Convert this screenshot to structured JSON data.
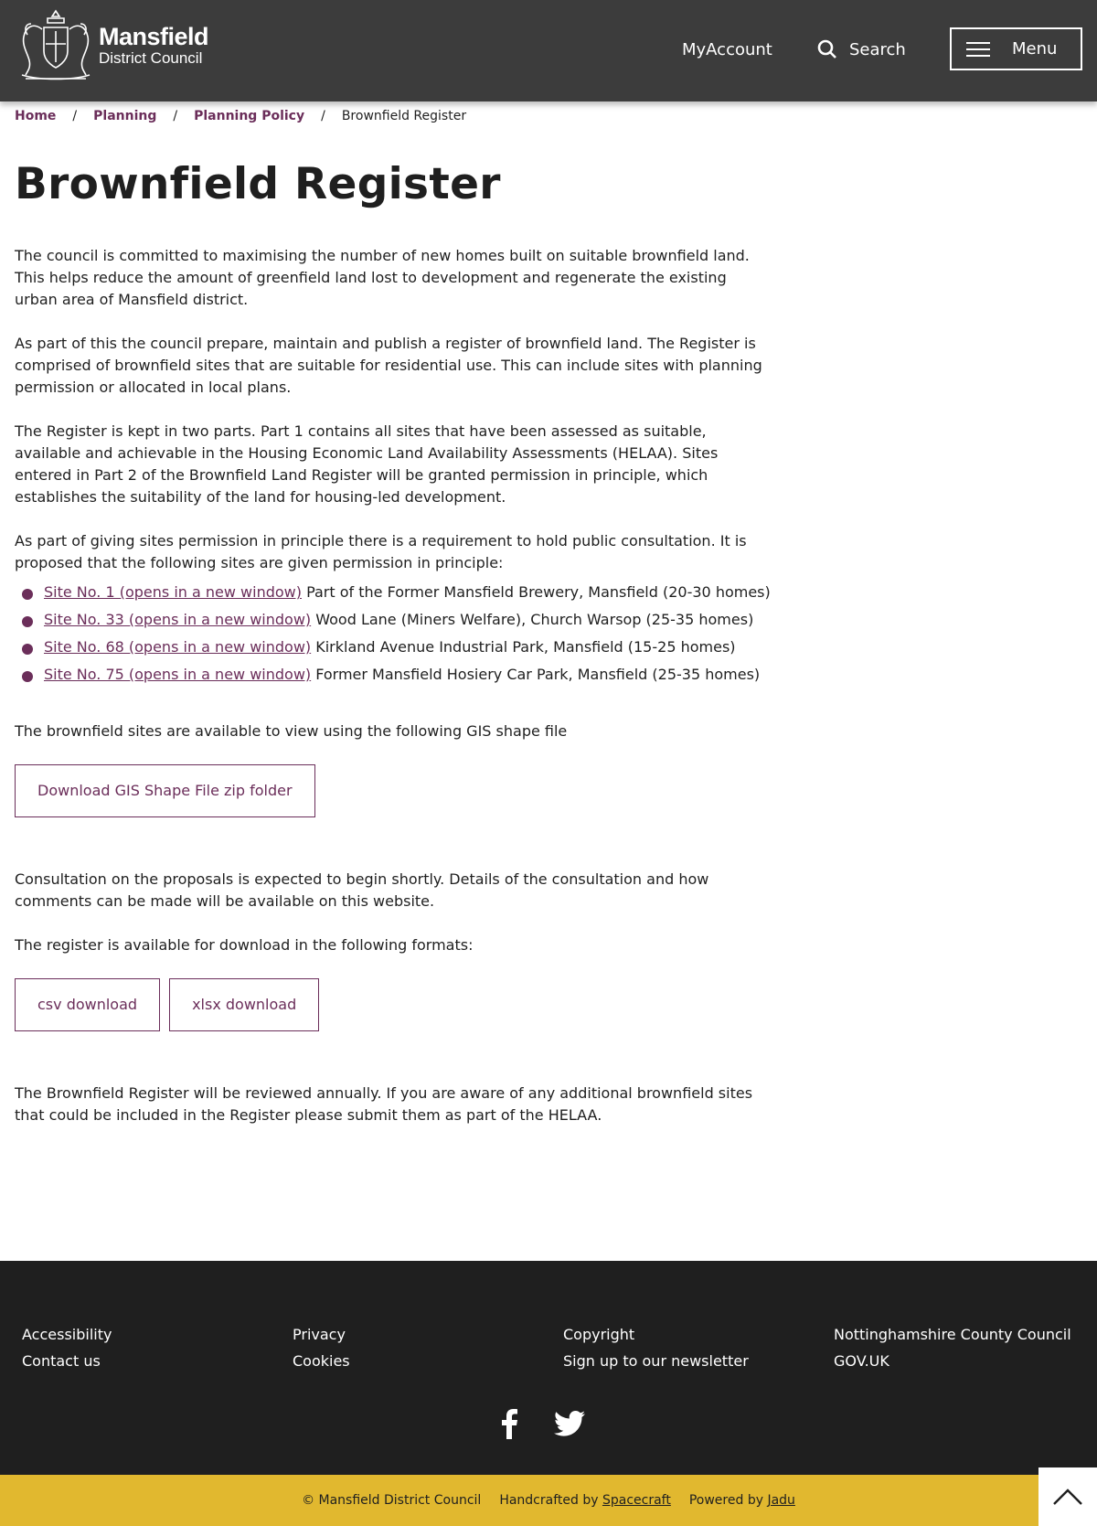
{
  "header": {
    "logo": {
      "name": "Mansfield",
      "subtitle": "District Council"
    },
    "myaccount_label": "MyAccount",
    "search_label": "Search",
    "menu_label": "Menu"
  },
  "breadcrumb": {
    "items": [
      "Home",
      "Planning",
      "Planning Policy"
    ],
    "separator": "/",
    "current": "Brownfield Register"
  },
  "main": {
    "title": "Brownfield Register",
    "paragraphs": [
      "The council is committed to maximising the number of new homes built on suitable brownfield land. This helps reduce the amount of greenfield land lost to development and regenerate the existing urban area of Mansfield district.",
      "As part of this the council prepare, maintain and publish a register of brownfield land. The Register is comprised of brownfield sites that are suitable for residential use. This can include sites with planning permission or allocated in local plans.",
      "The Register is kept in two parts. Part 1 contains all sites that have been assessed as suitable, available and achievable in the Housing Economic Land Availability Assessments (HELAA). Sites entered in Part 2 of the Brownfield Land Register will be granted permission in principle, which establishes the suitability of the land for housing-led development.",
      "As part of giving sites permission in principle there is a requirement to hold public consultation. It is proposed that the following sites are given permission in principle:"
    ],
    "sites": [
      {
        "link": "Site No. 1 (opens in a new window)",
        "text": " Part of the Former Mansfield Brewery, Mansfield  (20-30 homes)"
      },
      {
        "link": "Site No. 33 (opens in a new window)",
        "text": " Wood Lane (Miners Welfare), Church Warsop (25-35 homes)"
      },
      {
        "link": "Site No. 68 (opens in a new window)",
        "text": " Kirkland Avenue Industrial Park, Mansfield (15-25 homes)"
      },
      {
        "link": "Site No. 75 (opens in a new window)",
        "text": " Former Mansfield Hosiery Car Park, Mansfield (25-35 homes)"
      }
    ],
    "gis_text": "The brownfield sites are available to view using the following GIS shape file",
    "gis_button": "Download GIS Shape File zip folder",
    "consultation_text": "Consultation on the proposals is expected to begin shortly.  Details of the consultation and how comments can be made will be available on this website.",
    "formats_text": "The register is available for download in the following formats:",
    "csv_button": "csv download",
    "xlsx_button": "xlsx download",
    "review_text": "The Brownfield Register will be reviewed annually. If you are aware of any additional brownfield sites that could be included in the Register please submit them as part of the HELAA."
  },
  "footer": {
    "columns": [
      [
        "Accessibility",
        "Contact us"
      ],
      [
        "Privacy",
        "Cookies"
      ],
      [
        "Copyright",
        "Sign up to our newsletter"
      ],
      [
        "Nottinghamshire County Council",
        "GOV.UK"
      ]
    ],
    "social_icons": [
      "facebook-icon",
      "twitter-icon"
    ],
    "copyright": "© Mansfield District Council",
    "handcrafted_prefix": "Handcrafted by ",
    "handcrafted_link": "Spacecraft",
    "powered_prefix": "Powered by ",
    "powered_link": "Jadu"
  },
  "colors": {
    "header_bg": "#3c3c3c",
    "accent": "#6b2e5a",
    "footer_bg": "#1f1f1f",
    "bottom_bar": "#e1b82f"
  }
}
